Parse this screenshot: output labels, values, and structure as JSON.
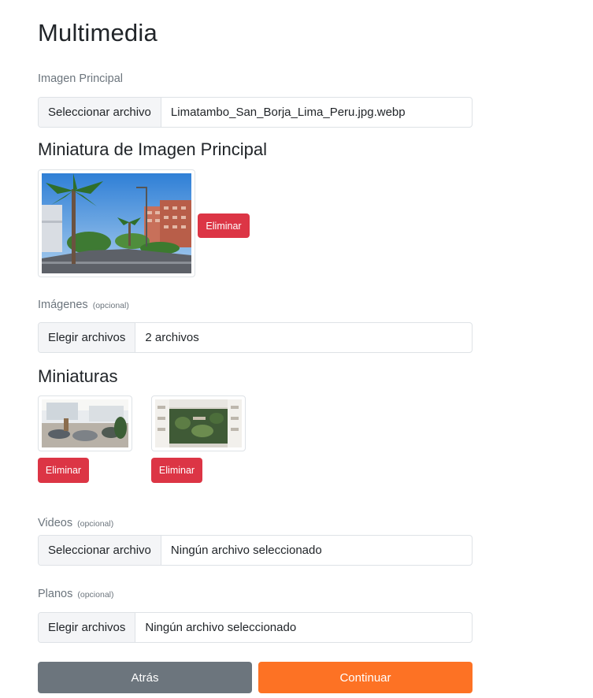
{
  "page": {
    "title": "Multimedia"
  },
  "main_image": {
    "label": "Imagen Principal",
    "button": "Seleccionar archivo",
    "file": "Limatambo_San_Borja_Lima_Peru.jpg.webp"
  },
  "main_thumb": {
    "title": "Miniatura de Imagen Principal",
    "delete": "Eliminar"
  },
  "images": {
    "label": "Imágenes",
    "optional": "(opcional)",
    "button": "Elegir archivos",
    "file": "2 archivos"
  },
  "thumbs": {
    "title": "Miniaturas",
    "items": [
      {
        "delete": "Eliminar"
      },
      {
        "delete": "Eliminar"
      }
    ]
  },
  "videos": {
    "label": "Videos",
    "optional": "(opcional)",
    "button": "Seleccionar archivo",
    "file": "Ningún archivo seleccionado"
  },
  "plans": {
    "label": "Planos",
    "optional": "(opcional)",
    "button": "Elegir archivos",
    "file": "Ningún archivo seleccionado"
  },
  "actions": {
    "back": "Atrás",
    "continue": "Continuar"
  },
  "colors": {
    "danger": "#dc3545",
    "secondary": "#6c757d",
    "accent": "#fd7224"
  }
}
